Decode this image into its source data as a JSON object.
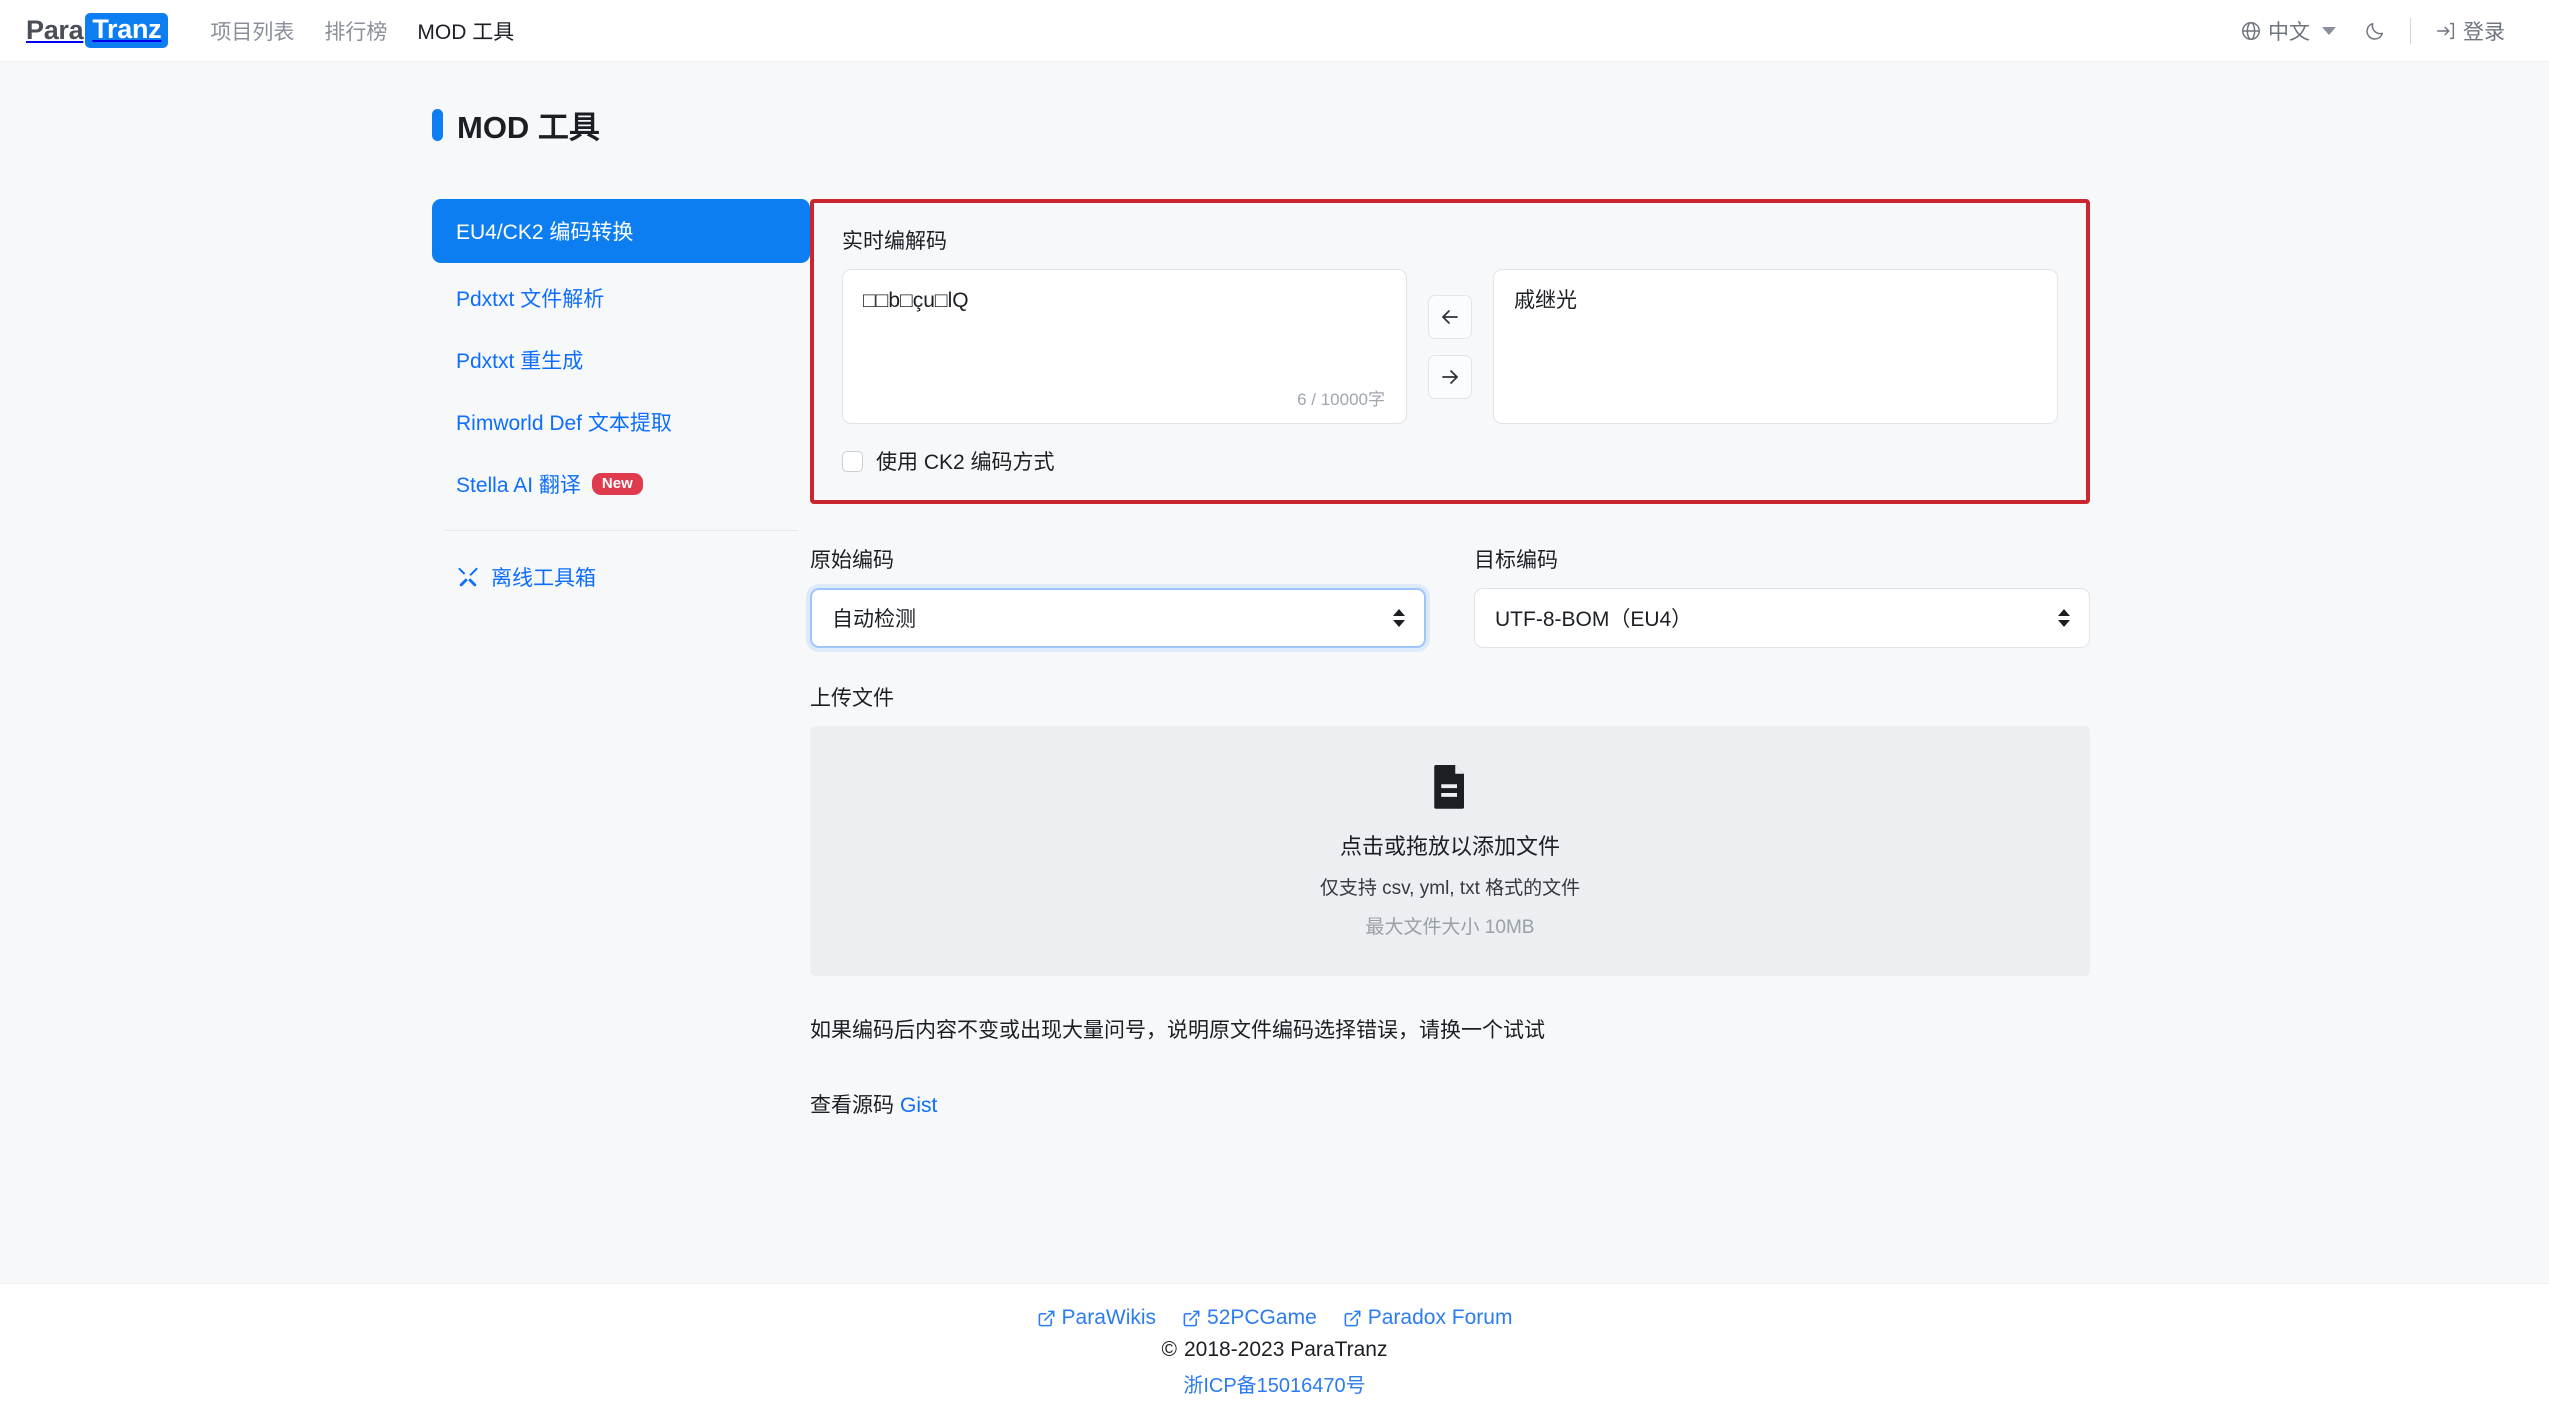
{
  "navbar": {
    "brand_para": "Para",
    "brand_tranz": "Tranz",
    "links": [
      {
        "label": "项目列表",
        "active": false
      },
      {
        "label": "排行榜",
        "active": false
      },
      {
        "label": "MOD 工具",
        "active": true
      }
    ],
    "language": {
      "icon": "globe-icon",
      "label": "中文"
    },
    "theme_toggle_icon": "moon-icon",
    "login": {
      "icon": "sign-in-icon",
      "label": "登录"
    }
  },
  "page": {
    "title": "MOD 工具",
    "accent_color": "#0d7ef2"
  },
  "sidebar": {
    "items": [
      {
        "label": "EU4/CK2 编码转换",
        "active": true,
        "badge": ""
      },
      {
        "label": "Pdxtxt 文件解析",
        "active": false,
        "badge": ""
      },
      {
        "label": "Pdxtxt 重生成",
        "active": false,
        "badge": ""
      },
      {
        "label": "Rimworld Def 文本提取",
        "active": false,
        "badge": ""
      },
      {
        "label": "Stella AI 翻译",
        "active": false,
        "badge": "New"
      }
    ],
    "offline_toolbox": {
      "label": "离线工具箱",
      "icon": "tools-icon"
    }
  },
  "codec": {
    "highlighted": true,
    "highlight_color": "#c9272d",
    "label": "实时编解码",
    "source_text": "□□b□çu□lQ",
    "char_count": "6 / 10000字",
    "target_text": "戚继光",
    "decode_button": "←",
    "encode_button": "→",
    "ck2_checkbox": {
      "label": "使用 CK2 编码方式",
      "checked": false
    }
  },
  "encodings": {
    "source_label": "原始编码",
    "source_value": "自动检测",
    "source_focused": true,
    "target_label": "目标编码",
    "target_value": "UTF-8-BOM（EU4）",
    "target_focused": false
  },
  "upload": {
    "label": "上传文件",
    "icon": "file-document-icon",
    "title": "点击或拖放以添加文件",
    "subtitle": "仅支持 csv, yml, txt 格式的文件",
    "hint": "最大文件大小 10MB"
  },
  "note": "如果编码后内容不变或出现大量问号，说明原文件编码选择错误，请换一个试试",
  "source_code": {
    "label": "查看源码",
    "link": "Gist"
  },
  "footer": {
    "links": [
      {
        "label": "ParaWikis",
        "icon": "external-link-icon"
      },
      {
        "label": "52PCGame",
        "icon": "external-link-icon"
      },
      {
        "label": "Paradox Forum",
        "icon": "external-link-icon"
      }
    ],
    "copyright": "2018-2023 ParaTranz",
    "copyright_symbol": "©",
    "icp": "浙ICP备15016470号"
  }
}
